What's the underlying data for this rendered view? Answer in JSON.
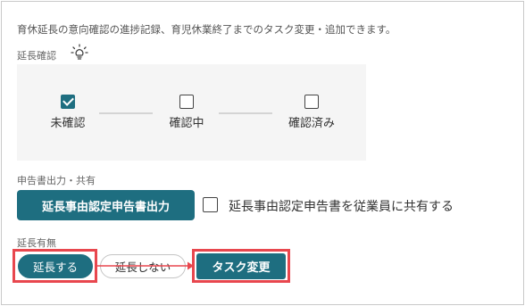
{
  "intro_text": "育休延長の意向確認の進捗記録、育児休業終了までのタスク変更・追加できます。",
  "confirm_section": {
    "label": "延長確認",
    "icon": "lightbulb-icon",
    "steps": [
      {
        "label": "未確認",
        "checked": true
      },
      {
        "label": "確認中",
        "checked": false
      },
      {
        "label": "確認済み",
        "checked": false
      }
    ]
  },
  "report_section": {
    "label": "申告書出力・共有",
    "output_button": "延長事由認定申告書出力",
    "share_checkbox_label": "延長事由認定申告書を従業員に共有する",
    "share_checked": false
  },
  "extension_section": {
    "label": "延長有無",
    "extend_button": "延長する",
    "no_extend_button": "延長しない",
    "task_change_button": "タスク変更",
    "selected": "延長する"
  },
  "colors": {
    "accent": "#1e6e80",
    "highlight": "#e8474e",
    "panel_bg": "#f5f5f5"
  }
}
